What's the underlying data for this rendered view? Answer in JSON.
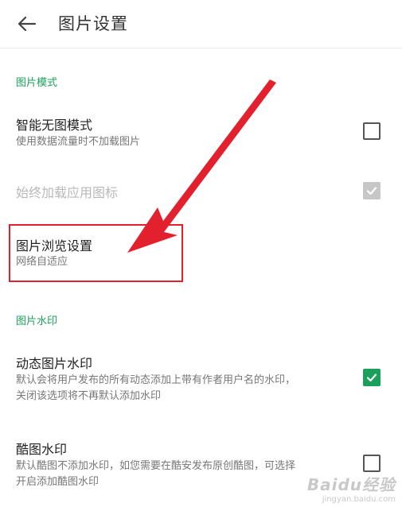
{
  "appbar": {
    "back_icon": "arrow-left-icon",
    "title": "图片设置"
  },
  "sections": [
    {
      "header": "图片模式"
    },
    {
      "header": "图片水印"
    }
  ],
  "settings": {
    "smart_no_image": {
      "title": "智能无图模式",
      "subtitle": "使用数据流量时不加载图片",
      "checked": false,
      "enabled": true
    },
    "always_load_icons": {
      "title": "始终加载应用图标",
      "checked": true,
      "enabled": false
    },
    "image_browse": {
      "title": "图片浏览设置",
      "subtitle": "网络自适应"
    },
    "dynamic_watermark": {
      "title": "动态图片水印",
      "subtitle_line1": "默认会将用户发布的所有动态添加上带有作者用户名的水印，",
      "subtitle_line2": "关闭该选项将不再默认添加水印",
      "checked": true,
      "enabled": true
    },
    "coolpic_watermark": {
      "title": "酷图水印",
      "subtitle_line1": "默认酷图不添加水印，如您需要在酷安发布原创酷图，可选择",
      "subtitle_line2": "开启添加酷图水印",
      "checked": false,
      "enabled": true
    }
  },
  "annotation": {
    "arrow_color": "#e3202d",
    "box_color": "#e3202d"
  },
  "colors": {
    "accent": "#1aa05b",
    "disabled": "#c7c7c7"
  },
  "watermark": {
    "logo": "Bai&#x5EA6;经验",
    "logo_text": "Baidu经验",
    "url": "jingyan.baidu.com"
  }
}
